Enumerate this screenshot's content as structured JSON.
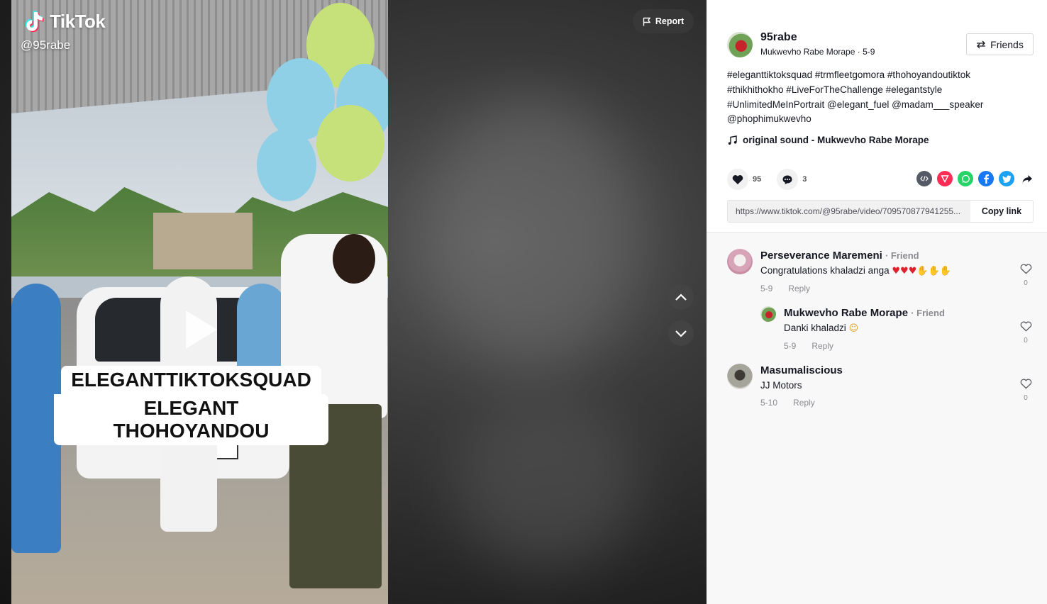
{
  "video": {
    "brand": "TikTok",
    "handle": "@95rabe",
    "caption_line1": "ELEGANTTIKTOKSQUAD",
    "caption_line2": "ELEGANT THOHOYANDOU",
    "report_label": "Report"
  },
  "post": {
    "username": "95rabe",
    "display_name": "Mukwevho Rabe Morape",
    "date": "5-9",
    "friends_label": "Friends",
    "description": "#eleganttiktoksquad #trmfleetgomora #thohoyandoutiktok #thikhithokho #LiveForTheChallenge #elegantstyle #UnlimitedMeInPortrait @elegant_fuel @madam___speaker @phophimukwevho",
    "sound": "original sound - Mukwevho Rabe Morape",
    "likes": "95",
    "comments_count": "3",
    "link_url": "https://www.tiktok.com/@95rabe/video/709570877941255...",
    "copy_link_label": "Copy link"
  },
  "comments": [
    {
      "name": "Perseverance Maremeni",
      "friend_label": "· Friend",
      "text": "Congratulations khaladzi anga",
      "emojis_hearts": "♥♥♥",
      "emojis_hands": "✋✋✋",
      "date": "5-9",
      "reply_label": "Reply",
      "likes": "0"
    },
    {
      "name": "Mukwevho Rabe Morape",
      "friend_label": "· Friend",
      "text": "Danki khaladzi",
      "emoji": "☺",
      "date": "5-9",
      "reply_label": "Reply",
      "likes": "0"
    },
    {
      "name": "Masumaliscious",
      "text": "JJ Motors",
      "date": "5-10",
      "reply_label": "Reply",
      "likes": "0"
    }
  ],
  "icons": {
    "share": [
      "embed-icon",
      "send-icon",
      "whatsapp-icon",
      "facebook-icon",
      "twitter-icon",
      "share-arrow-icon"
    ]
  },
  "colors": {
    "tiktok_red": "#fe2c55",
    "whatsapp": "#25d366",
    "facebook": "#1877f2",
    "twitter": "#1da1f2"
  }
}
